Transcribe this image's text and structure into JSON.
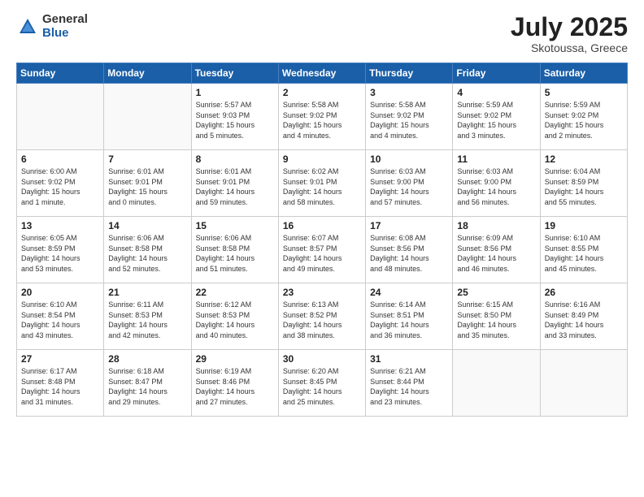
{
  "header": {
    "logo_general": "General",
    "logo_blue": "Blue",
    "title": "July 2025",
    "location": "Skotoussa, Greece"
  },
  "columns": [
    "Sunday",
    "Monday",
    "Tuesday",
    "Wednesday",
    "Thursday",
    "Friday",
    "Saturday"
  ],
  "weeks": [
    [
      {
        "day": "",
        "info": ""
      },
      {
        "day": "",
        "info": ""
      },
      {
        "day": "1",
        "info": "Sunrise: 5:57 AM\nSunset: 9:03 PM\nDaylight: 15 hours\nand 5 minutes."
      },
      {
        "day": "2",
        "info": "Sunrise: 5:58 AM\nSunset: 9:02 PM\nDaylight: 15 hours\nand 4 minutes."
      },
      {
        "day": "3",
        "info": "Sunrise: 5:58 AM\nSunset: 9:02 PM\nDaylight: 15 hours\nand 4 minutes."
      },
      {
        "day": "4",
        "info": "Sunrise: 5:59 AM\nSunset: 9:02 PM\nDaylight: 15 hours\nand 3 minutes."
      },
      {
        "day": "5",
        "info": "Sunrise: 5:59 AM\nSunset: 9:02 PM\nDaylight: 15 hours\nand 2 minutes."
      }
    ],
    [
      {
        "day": "6",
        "info": "Sunrise: 6:00 AM\nSunset: 9:02 PM\nDaylight: 15 hours\nand 1 minute."
      },
      {
        "day": "7",
        "info": "Sunrise: 6:01 AM\nSunset: 9:01 PM\nDaylight: 15 hours\nand 0 minutes."
      },
      {
        "day": "8",
        "info": "Sunrise: 6:01 AM\nSunset: 9:01 PM\nDaylight: 14 hours\nand 59 minutes."
      },
      {
        "day": "9",
        "info": "Sunrise: 6:02 AM\nSunset: 9:01 PM\nDaylight: 14 hours\nand 58 minutes."
      },
      {
        "day": "10",
        "info": "Sunrise: 6:03 AM\nSunset: 9:00 PM\nDaylight: 14 hours\nand 57 minutes."
      },
      {
        "day": "11",
        "info": "Sunrise: 6:03 AM\nSunset: 9:00 PM\nDaylight: 14 hours\nand 56 minutes."
      },
      {
        "day": "12",
        "info": "Sunrise: 6:04 AM\nSunset: 8:59 PM\nDaylight: 14 hours\nand 55 minutes."
      }
    ],
    [
      {
        "day": "13",
        "info": "Sunrise: 6:05 AM\nSunset: 8:59 PM\nDaylight: 14 hours\nand 53 minutes."
      },
      {
        "day": "14",
        "info": "Sunrise: 6:06 AM\nSunset: 8:58 PM\nDaylight: 14 hours\nand 52 minutes."
      },
      {
        "day": "15",
        "info": "Sunrise: 6:06 AM\nSunset: 8:58 PM\nDaylight: 14 hours\nand 51 minutes."
      },
      {
        "day": "16",
        "info": "Sunrise: 6:07 AM\nSunset: 8:57 PM\nDaylight: 14 hours\nand 49 minutes."
      },
      {
        "day": "17",
        "info": "Sunrise: 6:08 AM\nSunset: 8:56 PM\nDaylight: 14 hours\nand 48 minutes."
      },
      {
        "day": "18",
        "info": "Sunrise: 6:09 AM\nSunset: 8:56 PM\nDaylight: 14 hours\nand 46 minutes."
      },
      {
        "day": "19",
        "info": "Sunrise: 6:10 AM\nSunset: 8:55 PM\nDaylight: 14 hours\nand 45 minutes."
      }
    ],
    [
      {
        "day": "20",
        "info": "Sunrise: 6:10 AM\nSunset: 8:54 PM\nDaylight: 14 hours\nand 43 minutes."
      },
      {
        "day": "21",
        "info": "Sunrise: 6:11 AM\nSunset: 8:53 PM\nDaylight: 14 hours\nand 42 minutes."
      },
      {
        "day": "22",
        "info": "Sunrise: 6:12 AM\nSunset: 8:53 PM\nDaylight: 14 hours\nand 40 minutes."
      },
      {
        "day": "23",
        "info": "Sunrise: 6:13 AM\nSunset: 8:52 PM\nDaylight: 14 hours\nand 38 minutes."
      },
      {
        "day": "24",
        "info": "Sunrise: 6:14 AM\nSunset: 8:51 PM\nDaylight: 14 hours\nand 36 minutes."
      },
      {
        "day": "25",
        "info": "Sunrise: 6:15 AM\nSunset: 8:50 PM\nDaylight: 14 hours\nand 35 minutes."
      },
      {
        "day": "26",
        "info": "Sunrise: 6:16 AM\nSunset: 8:49 PM\nDaylight: 14 hours\nand 33 minutes."
      }
    ],
    [
      {
        "day": "27",
        "info": "Sunrise: 6:17 AM\nSunset: 8:48 PM\nDaylight: 14 hours\nand 31 minutes."
      },
      {
        "day": "28",
        "info": "Sunrise: 6:18 AM\nSunset: 8:47 PM\nDaylight: 14 hours\nand 29 minutes."
      },
      {
        "day": "29",
        "info": "Sunrise: 6:19 AM\nSunset: 8:46 PM\nDaylight: 14 hours\nand 27 minutes."
      },
      {
        "day": "30",
        "info": "Sunrise: 6:20 AM\nSunset: 8:45 PM\nDaylight: 14 hours\nand 25 minutes."
      },
      {
        "day": "31",
        "info": "Sunrise: 6:21 AM\nSunset: 8:44 PM\nDaylight: 14 hours\nand 23 minutes."
      },
      {
        "day": "",
        "info": ""
      },
      {
        "day": "",
        "info": ""
      }
    ]
  ]
}
